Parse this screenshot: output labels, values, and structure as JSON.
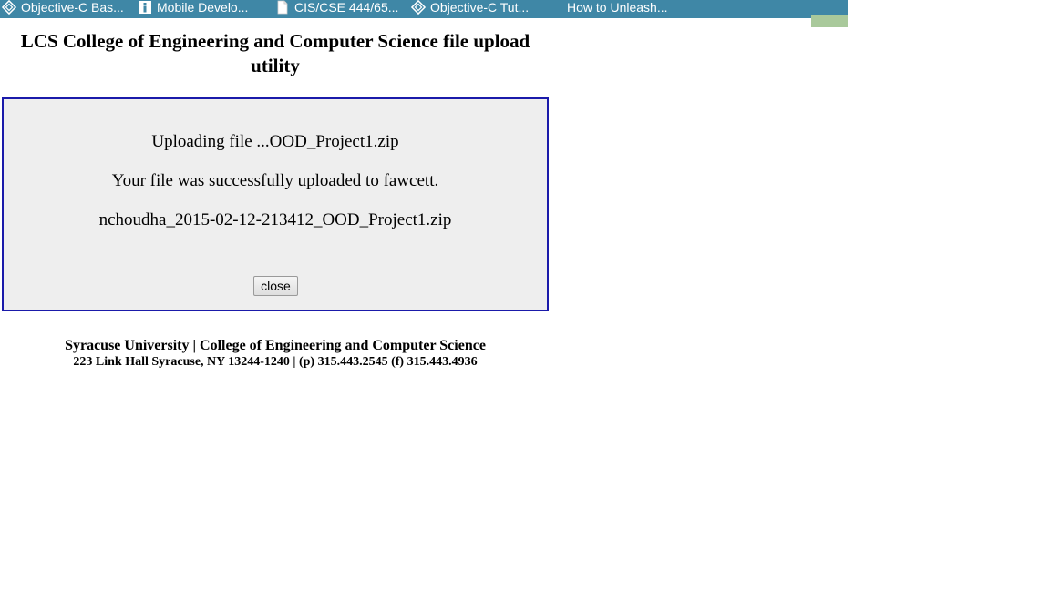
{
  "bookmarks": [
    {
      "label": "Objective-C Bas...",
      "icon": "tutorialspoint-icon"
    },
    {
      "label": "Mobile Develo...",
      "icon": "info-icon"
    },
    {
      "label": "CIS/CSE 444/65...",
      "icon": "document-icon"
    },
    {
      "label": "Objective-C Tut...",
      "icon": "tutorialspoint-icon"
    },
    {
      "label": "How to Unleash...",
      "icon": ""
    }
  ],
  "page": {
    "title": "LCS College of Engineering and Computer Science file upload utility"
  },
  "status": {
    "uploading": "Uploading file ...OOD_Project1.zip",
    "success": "Your file was successfully uploaded to fawcett.",
    "filename": "nchoudha_2015-02-12-213412_OOD_Project1.zip",
    "close_label": "close"
  },
  "footer": {
    "line1": "Syracuse University | College of Engineering and Computer Science",
    "line2": "223 Link Hall Syracuse, NY 13244-1240 | (p) 315.443.2545 (f) 315.443.4936"
  },
  "colors": {
    "bookmarks_bar": "#3f87a6",
    "box_border": "#1a1aaa",
    "box_background": "#eeeeee"
  }
}
